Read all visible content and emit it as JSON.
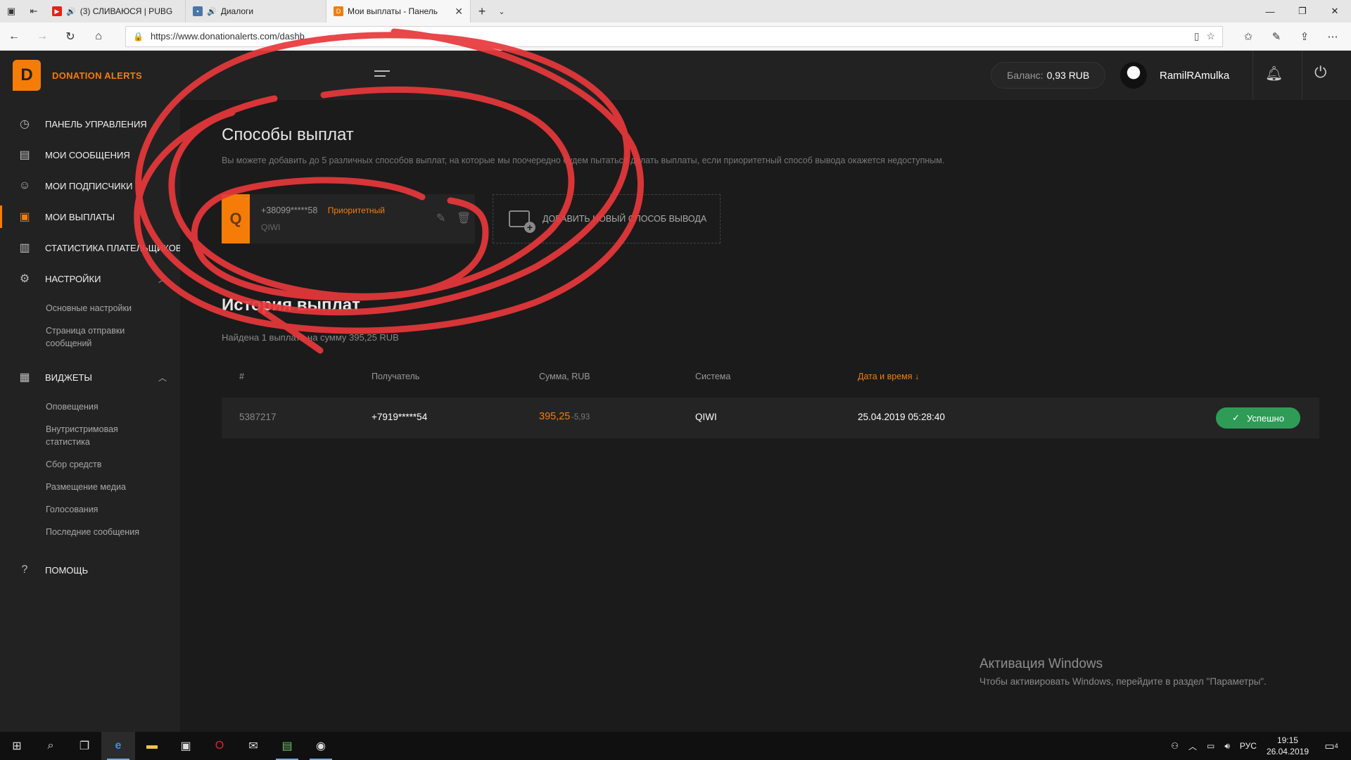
{
  "browser": {
    "tabs": [
      {
        "title": "(3) СЛИВАЮСЯ | PUBG",
        "favicon": "youtube-icon",
        "favicon_color": "#e62117",
        "audio": true,
        "active": false
      },
      {
        "title": "Диалоги",
        "favicon": "vk-icon",
        "favicon_color": "#4a76a8",
        "audio": true,
        "active": false
      },
      {
        "title": "Мои выплаты - Панель",
        "favicon": "donationalerts-icon",
        "favicon_color": "#f57d07",
        "audio": false,
        "active": true
      }
    ],
    "url": "https://www.donationalerts.com/dashb..."
  },
  "sidebar": {
    "brand": "DONATION ALERTS",
    "items": [
      {
        "label": "Панель управления",
        "icon": "dashboard-icon"
      },
      {
        "label": "Мои сообщения",
        "icon": "messages-icon"
      },
      {
        "label": "Мои подписчики",
        "icon": "user-icon"
      },
      {
        "label": "Мои выплаты",
        "icon": "wallet-icon",
        "active": true
      },
      {
        "label": "Статистика плательщиков",
        "icon": "stats-icon"
      },
      {
        "label": "Настройки",
        "icon": "gear-icon"
      }
    ],
    "settings_sub": [
      "Основные настройки",
      "Страница отправки сообщений"
    ],
    "widgets": {
      "label": "Виджеты",
      "icon": "grid-icon"
    },
    "widgets_sub": [
      "Оповещения",
      "Внутристримовая статистика",
      "Сбор средств",
      "Размещение медиа",
      "Голосования",
      "Последние сообщения"
    ],
    "help": {
      "label": "Помощь",
      "icon": "help-icon"
    }
  },
  "header": {
    "balance_label": "Баланс:",
    "balance_value": "0,93 RUB",
    "username": "RamilRAmulka"
  },
  "payout_methods": {
    "title": "Способы выплат",
    "description": "Вы можете добавить до 5 различных способов выплат, на которые мы поочередно будем пытаться делать выплаты, если приоритетный способ вывода окажется недоступным.",
    "card": {
      "number": "+38099*****58",
      "priority": "Приоритетный",
      "system": "QIWI"
    },
    "add_label": "Добавить новый способ вывода"
  },
  "history": {
    "title": "История выплат",
    "found": "Найдена 1 выплата на сумму 395,25 RUB",
    "columns": [
      "#",
      "Получатель",
      "Сумма, RUB",
      "Система",
      "Дата и время ↓"
    ],
    "rows": [
      {
        "id": "5387217",
        "recipient": "+7919*****54",
        "amount": "395,25",
        "fee": "-5,93",
        "system": "QIWI",
        "datetime": "25.04.2019 05:28:40",
        "status": "Успешно"
      }
    ]
  },
  "activation": {
    "title": "Активация Windows",
    "text": "Чтобы активировать Windows, перейдите в раздел \"Параметры\"."
  },
  "taskbar": {
    "time": "19:15",
    "date": "26.04.2019",
    "lang": "РУС",
    "notifications": "4"
  },
  "colors": {
    "accent": "#f57d07",
    "success": "#2e9c57",
    "annotation": "#e8383b"
  }
}
